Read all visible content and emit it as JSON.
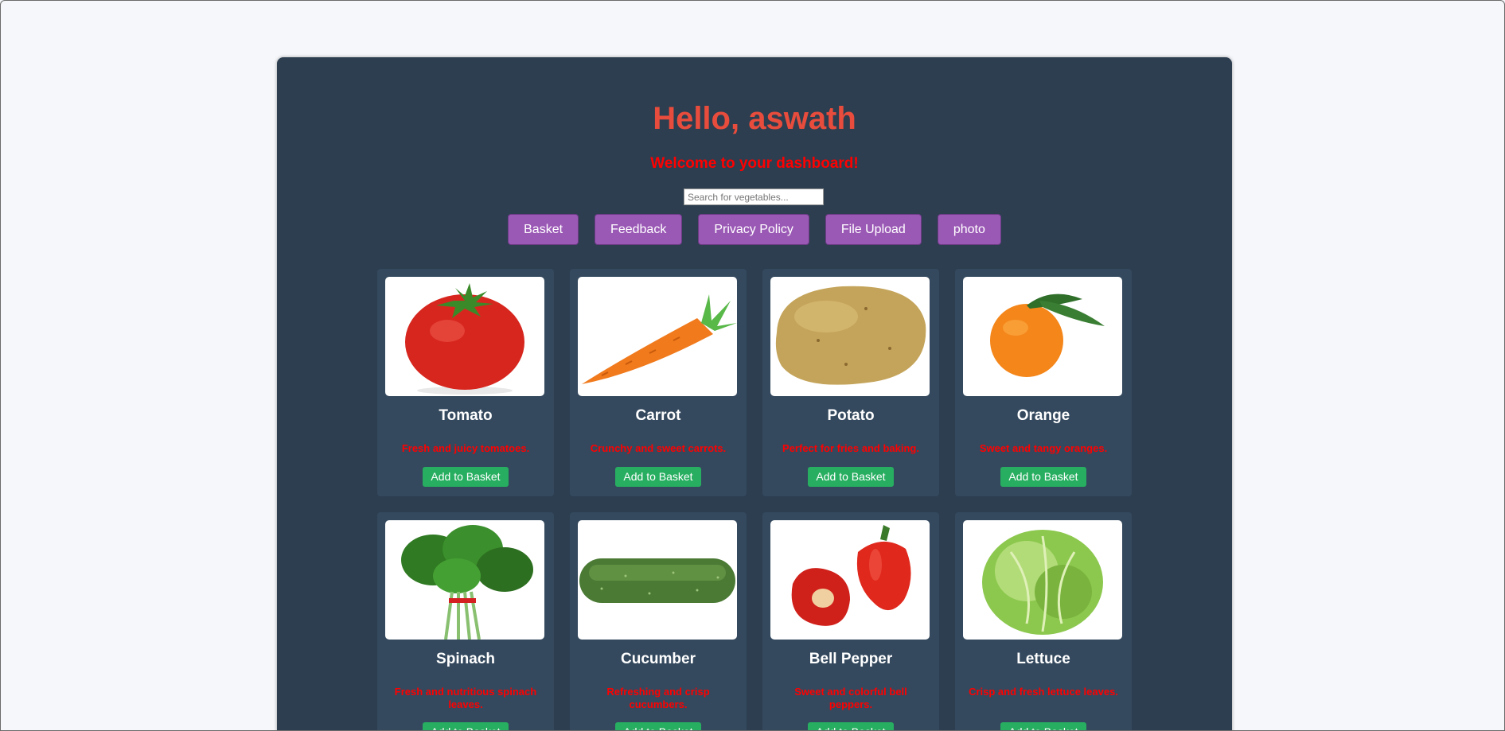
{
  "greeting": "Hello, aswath",
  "welcome": "Welcome to your dashboard!",
  "search": {
    "placeholder": "Search for vegetables..."
  },
  "nav": [
    {
      "label": "Basket"
    },
    {
      "label": "Feedback"
    },
    {
      "label": "Privacy Policy"
    },
    {
      "label": "File Upload"
    },
    {
      "label": "photo"
    }
  ],
  "add_label": "Add to Basket",
  "products": [
    {
      "name": "Tomato",
      "description": "Fresh and juicy tomatoes.",
      "icon": "tomato-image"
    },
    {
      "name": "Carrot",
      "description": "Crunchy and sweet carrots.",
      "icon": "carrot-image"
    },
    {
      "name": "Potato",
      "description": "Perfect for fries and baking.",
      "icon": "potato-image"
    },
    {
      "name": "Orange",
      "description": "Sweet and tangy oranges.",
      "icon": "orange-image"
    },
    {
      "name": "Spinach",
      "description": "Fresh and nutritious spinach leaves.",
      "icon": "spinach-image"
    },
    {
      "name": "Cucumber",
      "description": "Refreshing and crisp cucumbers.",
      "icon": "cucumber-image"
    },
    {
      "name": "Bell Pepper",
      "description": "Sweet and colorful bell peppers.",
      "icon": "bell-pepper-image"
    },
    {
      "name": "Lettuce",
      "description": "Crisp and fresh lettuce leaves.",
      "icon": "lettuce-image"
    }
  ],
  "colors": {
    "page_bg": "#f5f7fa",
    "panel_bg": "#2c3e50",
    "card_bg": "#34495e",
    "greeting": "#e74c3c",
    "welcome": "#ff0000",
    "nav_button": "#9b59b6",
    "add_button": "#27ae60"
  }
}
